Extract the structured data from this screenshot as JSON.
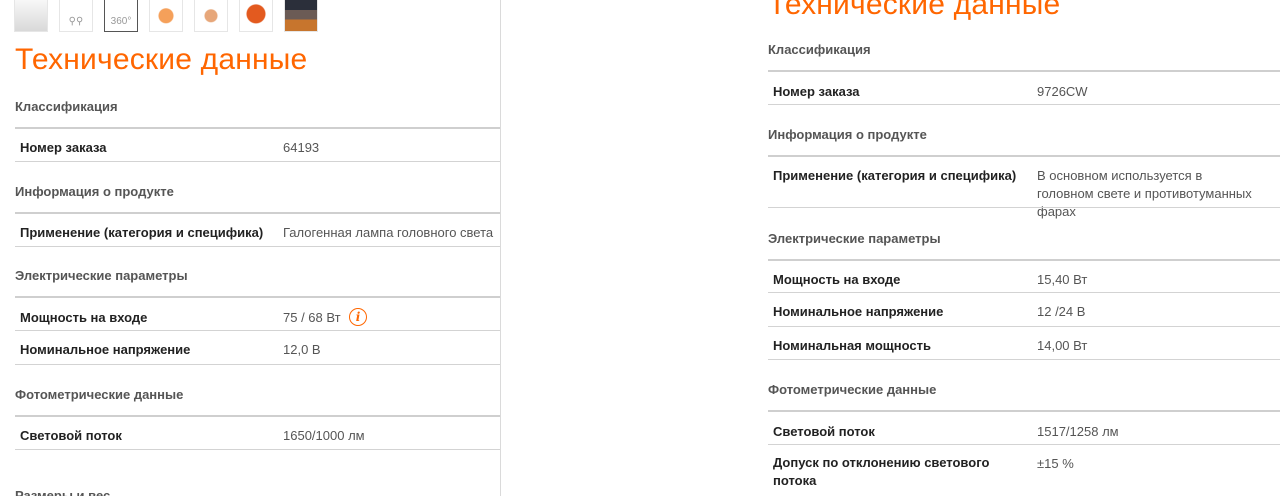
{
  "left": {
    "title": "Технические данные",
    "thumbnails": [
      {
        "icon": "lamp-pair-image"
      },
      {
        "icon": "lamp-pair-outline-image"
      },
      {
        "icon": "rotate-360-icon",
        "label": "360°"
      },
      {
        "icon": "package-box-image"
      },
      {
        "icon": "package-box-small-image"
      },
      {
        "icon": "package-red-box-image"
      },
      {
        "icon": "night-road-photo"
      }
    ],
    "sections": {
      "classification": "Классификация",
      "product_info": "Информация о продукте",
      "electrical": "Электрические параметры",
      "photometric": "Фотометрические данные",
      "dimensions_partial": "Размеры и вес"
    },
    "rows": {
      "order_number": {
        "label": "Номер заказа",
        "value": "64193"
      },
      "application": {
        "label": "Применение (категория и специфика)",
        "value": "Галогенная лампа головного света"
      },
      "input_power": {
        "label": "Мощность на входе",
        "value": "75 / 68 Вт"
      },
      "nominal_voltage": {
        "label": "Номинальное напряжение",
        "value": "12,0 В"
      },
      "luminous_flux": {
        "label": "Световой поток",
        "value": "1650/1000 лм"
      }
    },
    "info_icon": "i"
  },
  "right": {
    "title": "Технические данные",
    "sections": {
      "classification": "Классификация",
      "product_info": "Информация о продукте",
      "electrical": "Электрические параметры",
      "photometric": "Фотометрические данные"
    },
    "rows": {
      "order_number": {
        "label": "Номер заказа",
        "value": "9726CW"
      },
      "application": {
        "label": "Применение (категория и специфика)",
        "value": "В основном используется в головном свете и противотуманных фарах"
      },
      "input_power": {
        "label": "Мощность на входе",
        "value": "15,40 Вт"
      },
      "nominal_voltage": {
        "label": "Номинальное напряжение",
        "value": "12 /24 В"
      },
      "nominal_power": {
        "label": "Номинальная мощность",
        "value": "14,00 Вт"
      },
      "luminous_flux": {
        "label": "Световой поток",
        "value": "1517/1258 лм"
      },
      "flux_tolerance": {
        "label": "Допуск по отклонению светового потока",
        "value": "±15 %"
      }
    }
  },
  "colors": {
    "accent": "#ff6600",
    "divider": "#d3d3d3"
  }
}
